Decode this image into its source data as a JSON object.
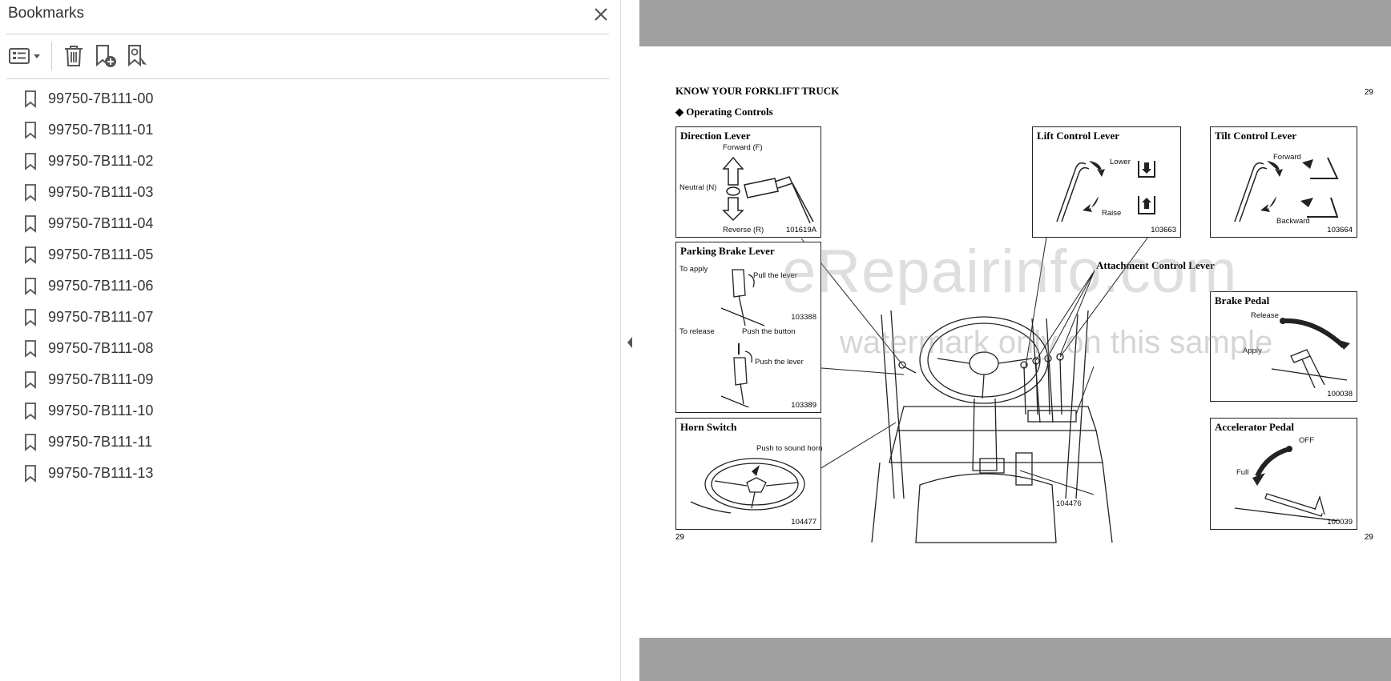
{
  "sidebar": {
    "title": "Bookmarks",
    "items": [
      {
        "label": "99750-7B111-00"
      },
      {
        "label": "99750-7B111-01"
      },
      {
        "label": "99750-7B111-02"
      },
      {
        "label": "99750-7B111-03"
      },
      {
        "label": "99750-7B111-04"
      },
      {
        "label": "99750-7B111-05"
      },
      {
        "label": "99750-7B111-06"
      },
      {
        "label": "99750-7B111-07"
      },
      {
        "label": "99750-7B111-08"
      },
      {
        "label": "99750-7B111-09"
      },
      {
        "label": "99750-7B111-10"
      },
      {
        "label": "99750-7B111-11"
      },
      {
        "label": "99750-7B111-13"
      }
    ]
  },
  "page": {
    "section_title": "KNOW YOUR FORKLIFT TRUCK",
    "page_number": "29",
    "subtitle": "Operating Controls",
    "footer_left": "29",
    "footer_right": "29",
    "main_figure_code": "104476",
    "callout_attachment": "Attachment Control Lever",
    "boxes": {
      "direction": {
        "title": "Direction Lever",
        "forward": "Forward (F)",
        "neutral": "Neutral (N)",
        "reverse": "Reverse (R)",
        "code": "101619A"
      },
      "parking": {
        "title": "Parking Brake Lever",
        "to_apply": "To apply",
        "pull": "Pull the lever",
        "code1": "103388",
        "to_release": "To release",
        "push_button": "Push the button",
        "push_lever": "Push the lever",
        "code2": "103389"
      },
      "horn": {
        "title": "Horn Switch",
        "push": "Push to sound horn",
        "code": "104477"
      },
      "lift": {
        "title": "Lift Control Lever",
        "lower": "Lower",
        "raise": "Raise",
        "code": "103663"
      },
      "tilt": {
        "title": "Tilt Control Lever",
        "forward": "Forward",
        "backward": "Backward",
        "code": "103664"
      },
      "brake": {
        "title": "Brake Pedal",
        "release": "Release",
        "apply": "Apply",
        "code": "100038"
      },
      "accel": {
        "title": "Accelerator Pedal",
        "off": "OFF",
        "full": "Full",
        "code": "100039"
      }
    }
  },
  "watermark": {
    "main": "eRepairinfo.com",
    "sub": "watermark only on this sample"
  },
  "colors": {
    "doc_gray": "#a0a0a0",
    "text": "#333333"
  },
  "icons": [
    "close-icon",
    "options-icon",
    "delete-icon",
    "add-bookmark-icon",
    "find-bookmark-icon",
    "bookmark-icon",
    "collapse-arrow-icon"
  ]
}
